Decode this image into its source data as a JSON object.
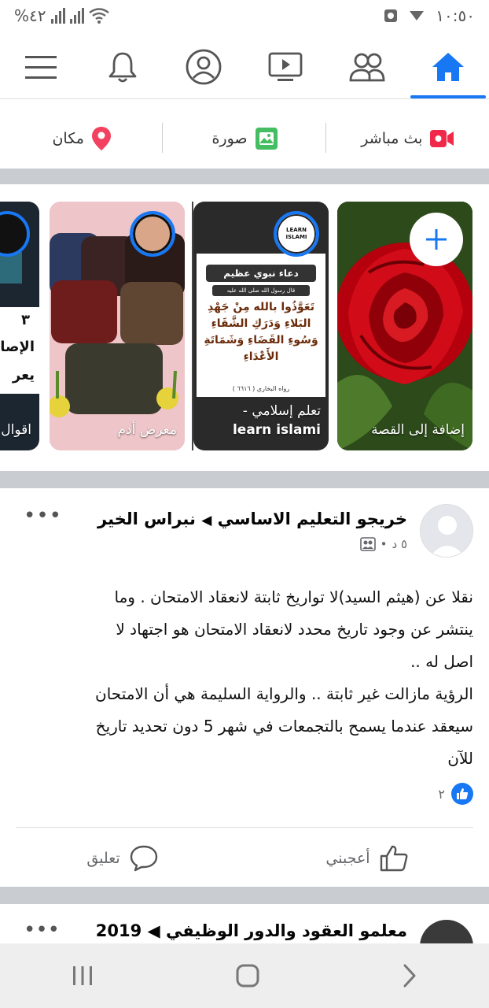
{
  "status_bar": {
    "battery": "%٤٢",
    "time": "١٠:٥٠"
  },
  "nav": {
    "tabs": [
      "menu",
      "notifications",
      "profile",
      "watch",
      "groups",
      "home"
    ]
  },
  "composer": {
    "live_label": "بث مباشر",
    "photo_label": "صورة",
    "place_label": "مكان"
  },
  "stories": [
    {
      "label": "إضافة إلى القصة"
    },
    {
      "label_line1": "تعلم إسلامي -",
      "label_line2": "learn islami",
      "card_title": "دعاء نبوي عظيم",
      "card_subtitle": "قال رسول الله صلى الله عليه",
      "card_verse": "تَعَوَّذُوا بالله مِنْ جَهْدِ البَلاءِ وَدَرَكِ الشَّقَاءِ وَسُوءِ القَضَاءِ وَشَمَاتَةِ الأَعْدَاءِ",
      "card_source": "رواه البخاري ( ٦٦١٦ )",
      "avatar_text": "LEARN ISLAMI"
    },
    {
      "label": "معرض أدم"
    },
    {
      "label": "اقوال",
      "text_1": "٣",
      "text_2": "الإصا",
      "text_3": "يعر"
    }
  ],
  "post": {
    "author": "خريجو التعليم الاساسي",
    "arrow": "◀",
    "group": "نبراس الخير",
    "time": "٥ د",
    "more": "•••",
    "text_lines": [
      "نقلا عن (هيثم السيد)لا تواريخ ثابتة لانعقاد الامتحان . وما",
      "ينتشر عن وجود تاريخ محدد لانعقاد الامتحان هو اجتهاد لا",
      "اصل له ..",
      "الرؤية مازالت غير ثابتة .. والرواية السليمة هي أن الامتحان",
      "سيعقد عندما يسمح بالتجمعات في شهر 5 دون تحديد تاريخ",
      "للآن"
    ],
    "reaction_count": "٢",
    "like_label": "أعجبني",
    "comment_label": "تعليق"
  },
  "post2": {
    "title": "معلمو العقود والدور الوظيفي ◀ 2019",
    "more": "•••"
  },
  "colors": {
    "accent": "#1877f2",
    "separator": "#c9ccd1",
    "live_red": "#f02849",
    "photo_green": "#45bd62",
    "place_pink": "#f3425f"
  }
}
